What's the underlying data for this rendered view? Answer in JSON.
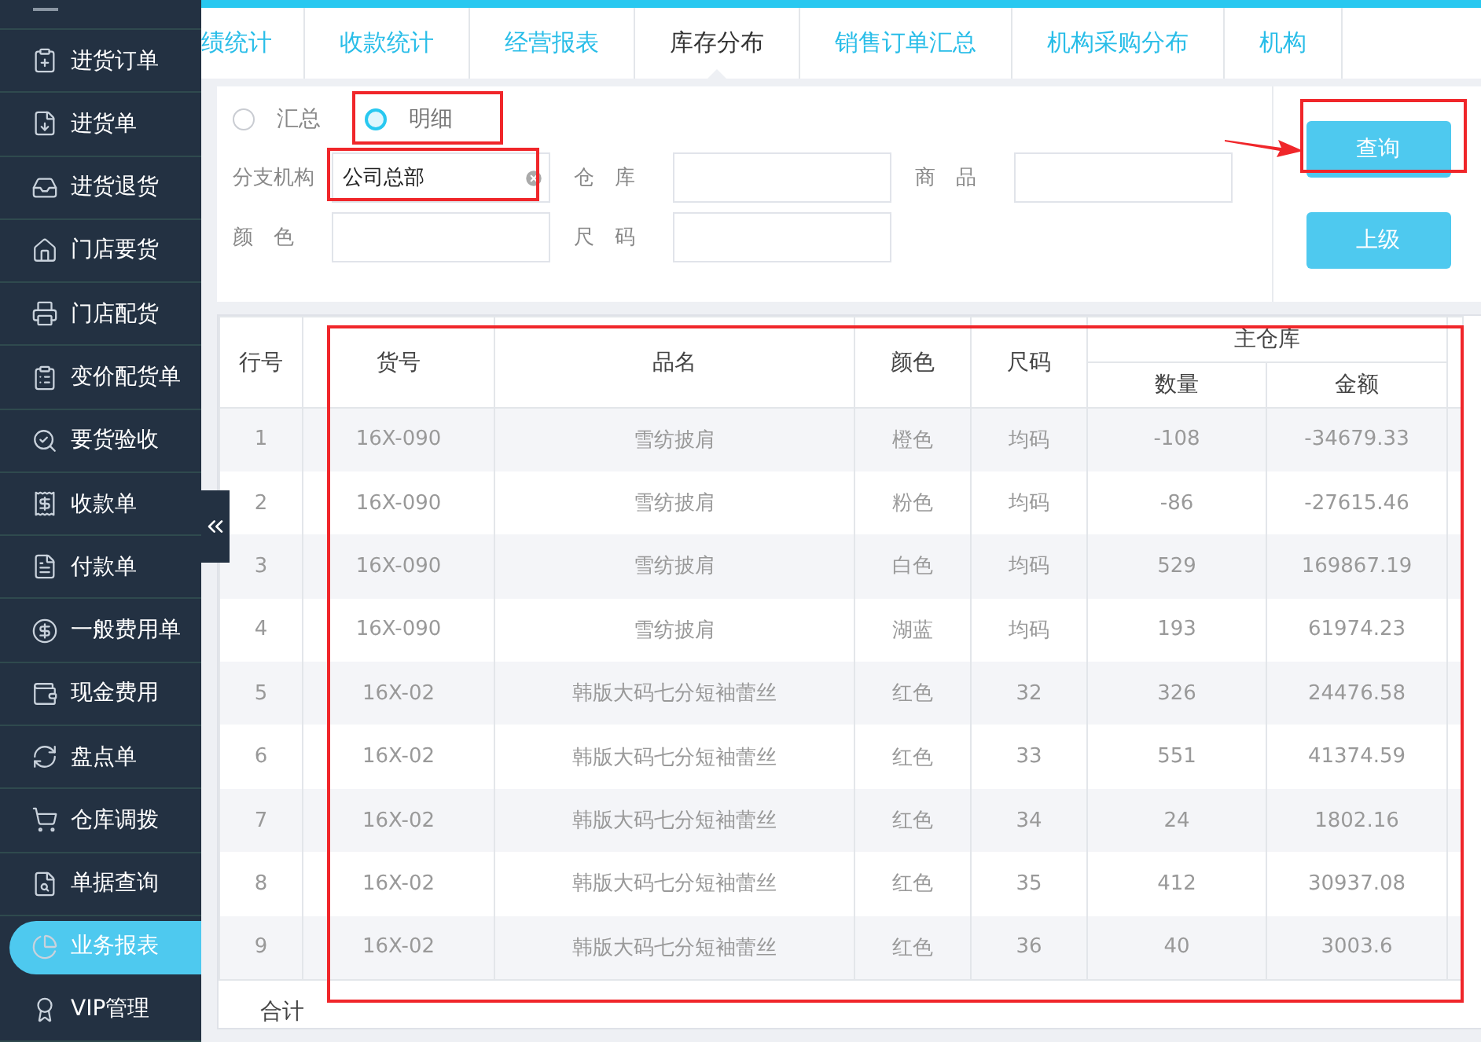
{
  "sidebar": {
    "items": [
      {
        "label": "进货订单",
        "selected": false
      },
      {
        "label": "进货单",
        "selected": false
      },
      {
        "label": "进货退货",
        "selected": false
      },
      {
        "label": "门店要货",
        "selected": false
      },
      {
        "label": "门店配货",
        "selected": false
      },
      {
        "label": "变价配货单",
        "selected": false
      },
      {
        "label": "要货验收",
        "selected": false
      },
      {
        "label": "收款单",
        "selected": false
      },
      {
        "label": "付款单",
        "selected": false
      },
      {
        "label": "一般费用单",
        "selected": false
      },
      {
        "label": "现金费用",
        "selected": false
      },
      {
        "label": "盘点单",
        "selected": false
      },
      {
        "label": "仓库调拨",
        "selected": false
      },
      {
        "label": "单据查询",
        "selected": false
      },
      {
        "label": "业务报表",
        "selected": true
      },
      {
        "label": "VIP管理",
        "selected": false
      }
    ]
  },
  "tabs": [
    {
      "label": "绩统计",
      "selected": false
    },
    {
      "label": "收款统计",
      "selected": false
    },
    {
      "label": "经营报表",
      "selected": false
    },
    {
      "label": "库存分布",
      "selected": true
    },
    {
      "label": "销售订单汇总",
      "selected": false
    },
    {
      "label": "机构采购分布",
      "selected": false
    },
    {
      "label": "机构",
      "selected": false
    }
  ],
  "filters": {
    "modes": [
      {
        "label": "汇总",
        "selected": false,
        "highlighted": false
      },
      {
        "label": "明细",
        "selected": true,
        "highlighted": true
      }
    ],
    "fields": [
      {
        "label": "分支机构",
        "value": "公司总部",
        "clearable": true,
        "highlighted": true
      },
      {
        "label": "仓　库",
        "clearable": false,
        "highlighted": false
      },
      {
        "label": "商　品",
        "clearable": false,
        "highlighted": false
      },
      {
        "label": "颜　色",
        "clearable": false,
        "highlighted": false
      },
      {
        "label": "尺　码",
        "clearable": false,
        "highlighted": false
      }
    ],
    "pointer_arrow": true,
    "buttons": [
      {
        "label": "查询",
        "highlighted": true
      },
      {
        "label": "上级",
        "highlighted": false
      }
    ]
  },
  "table": {
    "highlighted": true,
    "group_header": "主仓库",
    "columns": [
      "行号",
      "货号",
      "品名",
      "颜色",
      "尺码",
      "数量",
      "金额"
    ],
    "rows": [
      [
        "1",
        "16X-090",
        "雪纺披肩",
        "橙色",
        "均码",
        "-108",
        "-34679.33"
      ],
      [
        "2",
        "16X-090",
        "雪纺披肩",
        "粉色",
        "均码",
        "-86",
        "-27615.46"
      ],
      [
        "3",
        "16X-090",
        "雪纺披肩",
        "白色",
        "均码",
        "529",
        "169867.19"
      ],
      [
        "4",
        "16X-090",
        "雪纺披肩",
        "湖蓝",
        "均码",
        "193",
        "61974.23"
      ],
      [
        "5",
        "16X-02",
        "韩版大码七分短袖蕾丝",
        "红色",
        "32",
        "326",
        "24476.58"
      ],
      [
        "6",
        "16X-02",
        "韩版大码七分短袖蕾丝",
        "红色",
        "33",
        "551",
        "41374.59"
      ],
      [
        "7",
        "16X-02",
        "韩版大码七分短袖蕾丝",
        "红色",
        "34",
        "24",
        "1802.16"
      ],
      [
        "8",
        "16X-02",
        "韩版大码七分短袖蕾丝",
        "红色",
        "35",
        "412",
        "30937.08"
      ],
      [
        "9",
        "16X-02",
        "韩版大码七分短袖蕾丝",
        "红色",
        "36",
        "40",
        "3003.6"
      ]
    ],
    "total_label": "合计"
  }
}
